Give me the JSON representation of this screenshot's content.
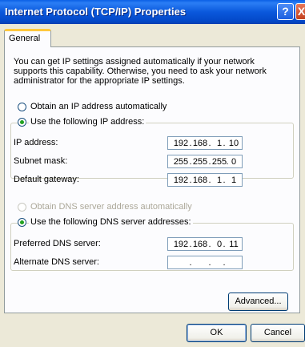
{
  "window": {
    "title": "Internet Protocol (TCP/IP) Properties",
    "help_icon": "?",
    "close_icon": "X"
  },
  "tabs": [
    {
      "label": "General",
      "active": true
    }
  ],
  "intro_text": "You can get IP settings assigned automatically if your network supports this capability. Otherwise, you need to ask your network administrator for the appropriate IP settings.",
  "ip": {
    "auto_radio": {
      "label": "Obtain an IP address automatically",
      "checked": false
    },
    "manual_radio": {
      "label": "Use the following IP address:",
      "checked": true
    },
    "fields": [
      {
        "label": "IP address:",
        "value": [
          "192",
          "168",
          "1",
          "10"
        ]
      },
      {
        "label": "Subnet mask:",
        "value": [
          "255",
          "255",
          "255",
          "0"
        ]
      },
      {
        "label": "Default gateway:",
        "value": [
          "192",
          "168",
          "1",
          "1"
        ]
      }
    ]
  },
  "dns": {
    "auto_radio": {
      "label": "Obtain DNS server address automatically",
      "checked": false,
      "disabled": true
    },
    "manual_radio": {
      "label": "Use the following DNS server addresses:",
      "checked": true
    },
    "fields": [
      {
        "label": "Preferred DNS server:",
        "value": [
          "192",
          "168",
          "0",
          "11"
        ]
      },
      {
        "label": "Alternate DNS server:",
        "value": [
          "",
          "",
          "",
          ""
        ]
      }
    ]
  },
  "buttons": {
    "advanced": "Advanced...",
    "ok": "OK",
    "cancel": "Cancel"
  },
  "colors": {
    "titlebar": "#0a58dc",
    "dialog_bg": "#ece9d8",
    "panel_bg": "#fcfcfe",
    "radio_dot": "#21a121",
    "tab_highlight": "#ffc83c"
  }
}
